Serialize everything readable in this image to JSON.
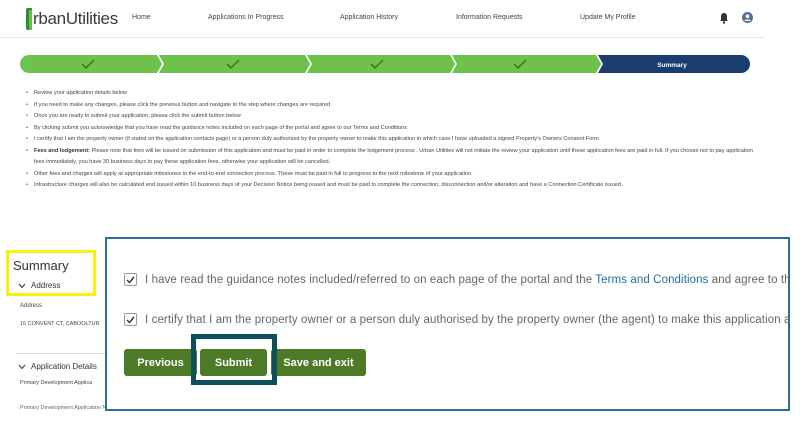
{
  "header": {
    "logo_text": "rbanUtilities",
    "nav": [
      "Home",
      "Applications In Progress",
      "Application History",
      "Information Requests",
      "Update My Profile"
    ],
    "icons": [
      "bell-icon",
      "user-icon"
    ]
  },
  "stepper": {
    "steps": [
      {
        "state": "complete",
        "icon": "check-icon"
      },
      {
        "state": "complete",
        "icon": "check-icon"
      },
      {
        "state": "complete",
        "icon": "check-icon"
      },
      {
        "state": "complete",
        "icon": "check-icon"
      },
      {
        "state": "current",
        "label": "Summary"
      }
    ],
    "colors": {
      "complete": "#6cc24a",
      "current": "#1a3c6e"
    }
  },
  "info": {
    "b1": "Review your application details below",
    "b2": "If you need to make any changes, please click the previous button and navigate to the step where changes are required",
    "b3": "Once you are ready to submit your application, please click the submit button below",
    "b4": "By clicking submit you acknowledge that you have read the guidance notes included on each page of the portal and agree to our Terms and Conditions",
    "b5": "I certify that I am the property owner (if stated on the application contacts page) or a person duly authorised by the property owner to make this application in which case I have uploaded a signed Property's Owners Consent Form",
    "b6_bold": "Fees and lodgement:",
    "b6": " Please note that fees will be issued on submission of this application and must be paid in order to complete the lodgement process . Urban Utilities will not initiate the review your application until these application fees are paid in full. If you choose not to pay application fees immediately, you have 30 business days to pay these application fees, otherwise your application will be cancelled.",
    "b7": "Other fees and charges will apply at appropriate milestones in the end-to-end connection process. These must be paid in full to progress to the next milestone of your application.",
    "b8": "Infrastructure charges will also be calculated and issued within 10 business days of your Decision Notice being issued and must be paid to complete the connection, disconnection and/or alteration and have a Connection Certificate issued."
  },
  "summary": {
    "title": "Summary",
    "address_section": "Address",
    "address_label": "Address",
    "address_value": "16 CONVENT CT, CABOOLTUR",
    "app_details_section": "Application Details",
    "primary_dev": "Primary Development Applica",
    "primary_dev2": "Primary Development Application Number"
  },
  "zoom": {
    "check1_pre": "I have read the guidance notes included/referred to on each page of the portal and the ",
    "check1_link": "Terms and Conditions",
    "check1_post": " and agree to tho",
    "check2": "I certify that I am the property owner or a person duly authorised by the property owner (the agent) to make this application as",
    "check1_checked": true,
    "check2_checked": true,
    "buttons": {
      "previous": "Previous",
      "submit": "Submit",
      "save_exit": "Save and exit"
    }
  },
  "colors": {
    "button": "#4c7a26",
    "highlight_yellow": "#f5f20f",
    "highlight_teal": "#0f4f5a",
    "link": "#1f6ea3"
  }
}
